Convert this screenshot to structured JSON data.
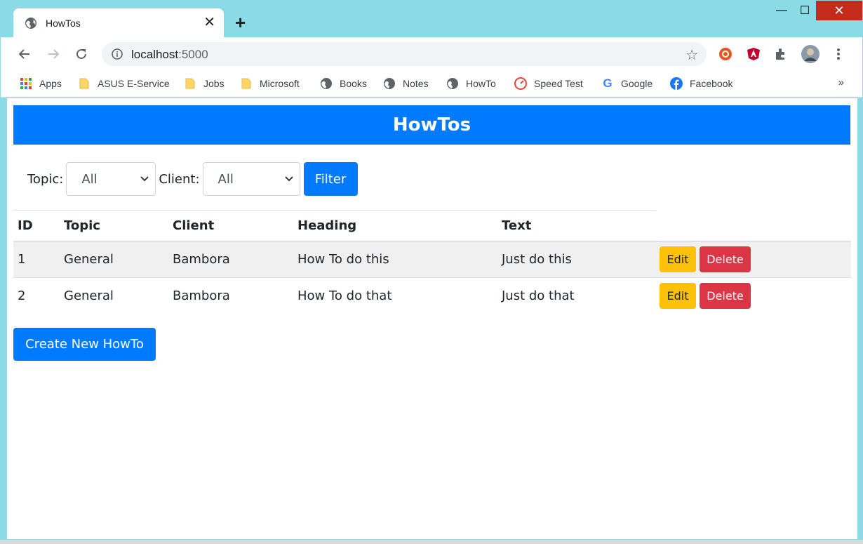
{
  "browser": {
    "tab_title": "HowTos",
    "tab_close": "✕",
    "new_tab": "+",
    "url_host": "localhost",
    "url_port": ":5000",
    "window_controls": {
      "minimize": "—",
      "maximize": "☐",
      "close": "✕"
    },
    "more_bookmarks": "»",
    "bookmarks": [
      {
        "label": "Apps",
        "icon": "apps-grid-icon"
      },
      {
        "label": "ASUS E-Service",
        "icon": "folder-icon"
      },
      {
        "label": "Jobs",
        "icon": "folder-icon"
      },
      {
        "label": "Microsoft",
        "icon": "folder-icon"
      },
      {
        "label": "Books",
        "icon": "globe-icon"
      },
      {
        "label": "Notes",
        "icon": "globe-icon"
      },
      {
        "label": "HowTo",
        "icon": "globe-icon"
      },
      {
        "label": "Speed Test",
        "icon": "speedometer-icon"
      },
      {
        "label": "Google",
        "icon": "google-icon"
      },
      {
        "label": "Facebook",
        "icon": "facebook-icon"
      }
    ]
  },
  "page": {
    "banner_title": "HowTos",
    "filters": {
      "topic_label": "Topic:",
      "topic_value": "All",
      "client_label": "Client:",
      "client_value": "All",
      "filter_button": "Filter"
    },
    "table": {
      "headers": [
        "ID",
        "Topic",
        "Client",
        "Heading",
        "Text"
      ],
      "rows": [
        {
          "id": "1",
          "topic": "General",
          "client": "Bambora",
          "heading": "How To do this",
          "text": "Just do this",
          "edit": "Edit",
          "delete": "Delete"
        },
        {
          "id": "2",
          "topic": "General",
          "client": "Bambora",
          "heading": "How To do that",
          "text": "Just do that",
          "edit": "Edit",
          "delete": "Delete"
        }
      ]
    },
    "create_button": "Create New HowTo"
  },
  "colors": {
    "primary": "#007bff",
    "warning": "#ffc107",
    "danger": "#dc3545",
    "frame": "#8adbe6"
  }
}
